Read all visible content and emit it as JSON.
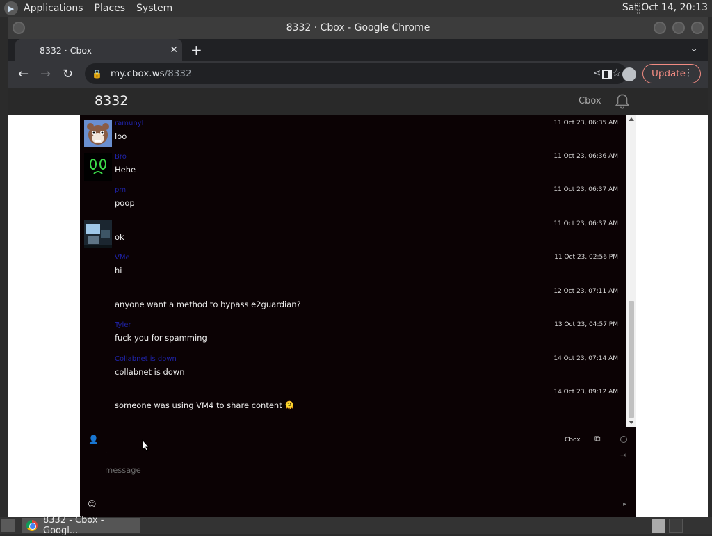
{
  "panel": {
    "menus": [
      "Applications",
      "Places",
      "System"
    ],
    "clock": "Sat Oct 14, 20:13"
  },
  "window": {
    "title": "8332 · Cbox - Google Chrome"
  },
  "browser": {
    "tab_title": "8332 · Cbox",
    "url_host": "my.cbox.ws",
    "url_path": "/8332",
    "update_label": "Update"
  },
  "cbox": {
    "room": "8332",
    "brand": "Cbox",
    "messages": [
      {
        "name": "ramunyl",
        "time": "11 Oct 23, 06:35 AM",
        "text": "loo",
        "avatar": "bear"
      },
      {
        "name": "Bro",
        "time": "11 Oct 23, 06:36 AM",
        "text": "Hehe",
        "avatar": "green-eyes"
      },
      {
        "name": "pm",
        "time": "11 Oct 23, 06:37 AM",
        "text": "poop",
        "avatar": "none"
      },
      {
        "name": "",
        "time": "11 Oct 23, 06:37 AM",
        "text": "ok",
        "avatar": "screens"
      },
      {
        "name": "VMe",
        "time": "11 Oct 23, 02:56 PM",
        "text": "hi",
        "avatar": "none"
      },
      {
        "name": "",
        "time": "12 Oct 23, 07:11 AM",
        "text": "anyone want a method to bypass e2guardian?",
        "avatar": "none"
      },
      {
        "name": "Tyler",
        "time": "13 Oct 23, 04:57 PM",
        "text": "fuck you for spamming",
        "avatar": "none"
      },
      {
        "name": "Collabnet is down",
        "time": "14 Oct 23, 07:14 AM",
        "text": "collabnet is down",
        "avatar": "none"
      },
      {
        "name": "",
        "time": "14 Oct 23, 09:12 AM",
        "text": "someone was using VM4 to share content 🫠",
        "avatar": "none"
      }
    ],
    "footer_brand": "Cbox",
    "message_placeholder": "message"
  },
  "taskbar": {
    "task_label": "8332 - Cbox - Googl..."
  }
}
